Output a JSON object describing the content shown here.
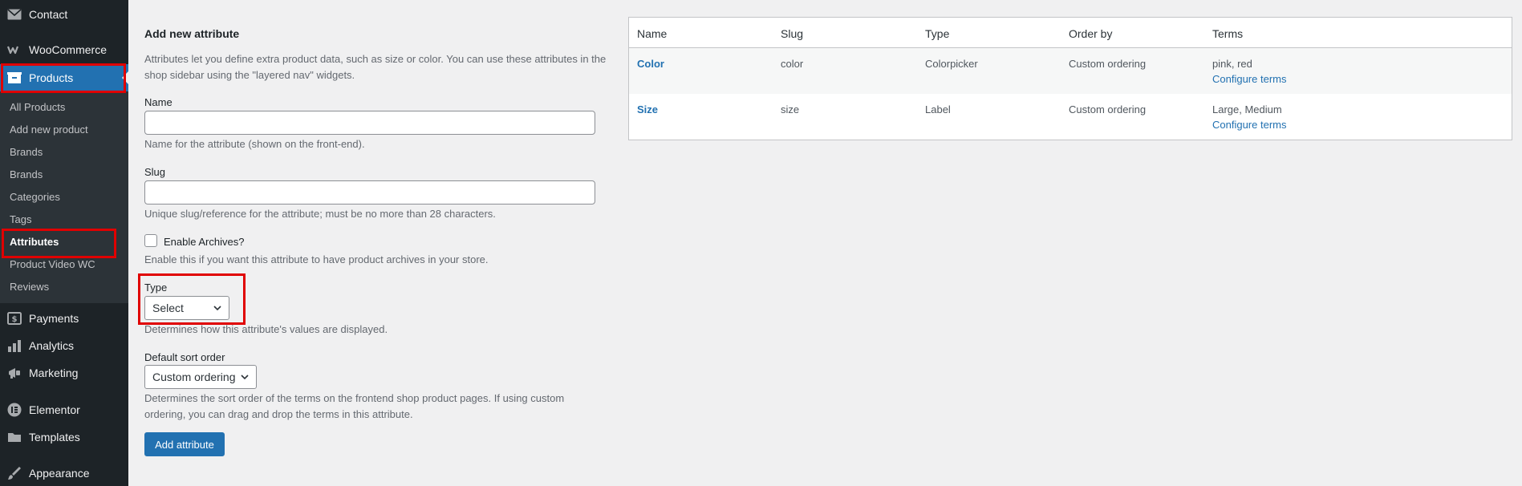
{
  "sidebar": {
    "top_items": [
      {
        "label": "Contact",
        "icon": "envelope-icon"
      },
      {
        "label": "WooCommerce",
        "icon": "woocommerce-icon"
      },
      {
        "label": "Products",
        "icon": "products-icon",
        "active": true
      }
    ],
    "submenu": [
      {
        "label": "All Products"
      },
      {
        "label": "Add new product"
      },
      {
        "label": "Brands"
      },
      {
        "label": "Brands"
      },
      {
        "label": "Categories"
      },
      {
        "label": "Tags"
      },
      {
        "label": "Attributes",
        "current": true
      },
      {
        "label": "Product Video WC"
      },
      {
        "label": "Reviews"
      }
    ],
    "bottom_items": [
      {
        "label": "Payments",
        "icon": "dollar-icon"
      },
      {
        "label": "Analytics",
        "icon": "bar-chart-icon"
      },
      {
        "label": "Marketing",
        "icon": "megaphone-icon"
      },
      {
        "label": "Elementor",
        "icon": "elementor-icon"
      },
      {
        "label": "Templates",
        "icon": "folder-icon"
      },
      {
        "label": "Appearance",
        "icon": "paintbrush-icon"
      }
    ]
  },
  "form": {
    "title": "Add new attribute",
    "intro_line1": "Attributes let you define extra product data, such as size or color. You can use these attributes in the",
    "intro_line2": "shop sidebar using the \"layered nav\" widgets.",
    "name_label": "Name",
    "name_value": "",
    "name_help": "Name for the attribute (shown on the front-end).",
    "slug_label": "Slug",
    "slug_value": "",
    "slug_help": "Unique slug/reference for the attribute; must be no more than 28 characters.",
    "archives_label": "Enable Archives?",
    "archives_checked": false,
    "archives_help": "Enable this if you want this attribute to have product archives in your store.",
    "type_label": "Type",
    "type_value": "Select",
    "type_help": "Determines how this attribute's values are displayed.",
    "sort_label": "Default sort order",
    "sort_value": "Custom ordering",
    "sort_help_line1": "Determines the sort order of the terms on the frontend shop product pages. If using custom",
    "sort_help_line2": "ordering, you can drag and drop the terms in this attribute.",
    "submit_label": "Add attribute"
  },
  "table": {
    "headers": [
      "Name",
      "Slug",
      "Type",
      "Order by",
      "Terms"
    ],
    "rows": [
      {
        "name": "Color",
        "slug": "color",
        "type": "Colorpicker",
        "order_by": "Custom ordering",
        "terms": "pink, red",
        "configure": "Configure terms"
      },
      {
        "name": "Size",
        "slug": "size",
        "type": "Label",
        "order_by": "Custom ordering",
        "terms": "Large, Medium",
        "configure": "Configure terms"
      }
    ]
  },
  "colors": {
    "sidebar_bg": "#1d2327",
    "submenu_bg": "#2c3338",
    "accent": "#2271b1",
    "highlight_box": "#e00000"
  }
}
